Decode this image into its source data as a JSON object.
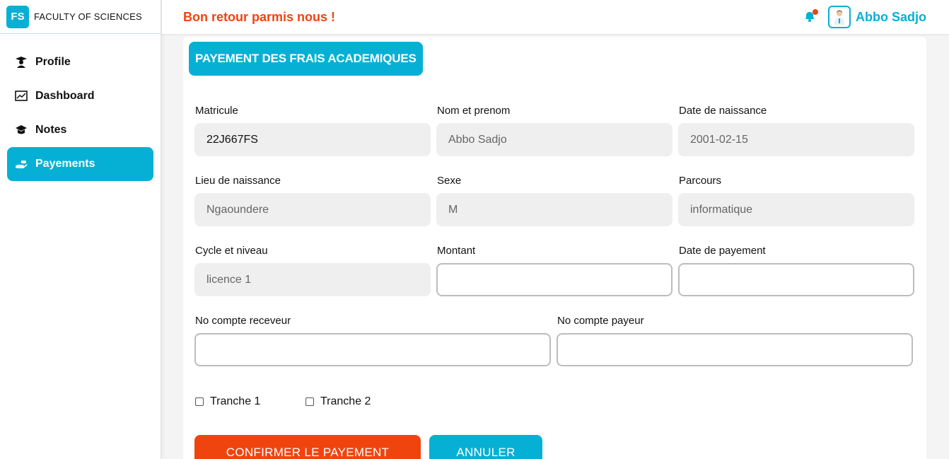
{
  "brand": {
    "logo": "FS",
    "name": "FACULTY OF SCIENCES"
  },
  "sidebar": {
    "items": [
      {
        "label": "Profile",
        "icon": "graduate-icon"
      },
      {
        "label": "Dashboard",
        "icon": "chart-icon"
      },
      {
        "label": "Notes",
        "icon": "mortarboard-icon"
      },
      {
        "label": "Payements",
        "icon": "hand-money-icon",
        "active": true
      }
    ]
  },
  "header": {
    "welcome": "Bon retour parmis nous !",
    "user_name": "Abbo Sadjo",
    "has_notification": true
  },
  "form": {
    "title": "PAYEMENT DES FRAIS ACADEMIQUES",
    "fields": {
      "matricule": {
        "label": "Matricule",
        "value": "22J667FS"
      },
      "nom": {
        "label": "Nom et prenom",
        "value": "Abbo Sadjo"
      },
      "naissance_date": {
        "label": "Date de naissance",
        "value": "2001-02-15"
      },
      "naissance_lieu": {
        "label": "Lieu de naissance",
        "value": "Ngaoundere"
      },
      "sexe": {
        "label": "Sexe",
        "value": "M"
      },
      "parcours": {
        "label": "Parcours",
        "value": "informatique"
      },
      "cycle": {
        "label": "Cycle et niveau",
        "value": "licence 1"
      },
      "montant": {
        "label": "Montant",
        "value": ""
      },
      "date_payement": {
        "label": "Date de payement",
        "value": ""
      },
      "compte_receveur": {
        "label": "No compte receveur",
        "value": ""
      },
      "compte_payeur": {
        "label": "No compte payeur",
        "value": ""
      }
    },
    "tranches": [
      {
        "label": "Tranche 1",
        "checked": false
      },
      {
        "label": "Tranche 2",
        "checked": false
      }
    ],
    "confirm_label": "CONFIRMER LE PAYEMENT",
    "cancel_label": "ANNULER"
  },
  "colors": {
    "accent": "#06b0d4",
    "danger": "#f0440f"
  }
}
